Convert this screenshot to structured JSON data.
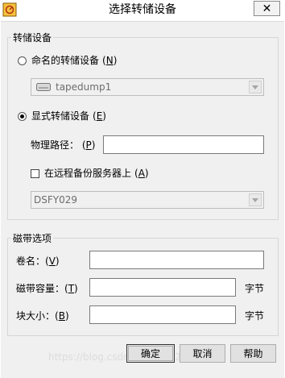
{
  "window": {
    "title": "选择转储设备",
    "close_glyph": "✕",
    "app_icon": "backup-app-icon"
  },
  "dump_device": {
    "group_label": "转储设备",
    "named_radio": {
      "label": "命名的转储设备",
      "accesskey": "N",
      "checked": false
    },
    "named_combo": {
      "value": "tapedump1",
      "icon": "tape-drive-icon",
      "enabled": false
    },
    "explicit_radio": {
      "label": "显式转储设备",
      "accesskey": "E",
      "checked": true
    },
    "physical_path": {
      "label": "物理路径：",
      "accesskey": "P",
      "value": ""
    },
    "remote_checkbox": {
      "label": "在远程备份服务器上",
      "accesskey": "A",
      "checked": false
    },
    "server_combo": {
      "value": "DSFY029",
      "enabled": false
    }
  },
  "tape_options": {
    "group_label": "磁带选项",
    "volume_name": {
      "label": "卷名：",
      "accesskey": "V",
      "value": ""
    },
    "tape_capacity": {
      "label": "磁带容量：",
      "accesskey": "T",
      "value": "",
      "unit": "字节"
    },
    "block_size": {
      "label": "块大小：",
      "accesskey": "B",
      "value": "",
      "unit": "字节"
    }
  },
  "buttons": {
    "ok": "确定",
    "cancel": "取消",
    "help": "帮助"
  },
  "watermark": "https://blog.csdn.net/qq_42017833",
  "colors": {
    "dialog_bg": "#f0f0f0",
    "disabled_text": "#6d6d6d",
    "border": "#d5d5d5"
  }
}
